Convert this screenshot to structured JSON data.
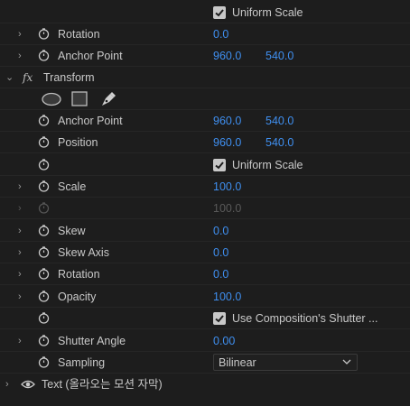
{
  "rows": {
    "uniform_scale_top": "Uniform Scale",
    "rotation_top": {
      "label": "Rotation",
      "value": "0.0"
    },
    "anchor_point_top": {
      "label": "Anchor Point",
      "x": "960.0",
      "y": "540.0"
    },
    "transform": {
      "fx": "fx",
      "label": "Transform"
    },
    "anchor_point": {
      "label": "Anchor Point",
      "x": "960.0",
      "y": "540.0"
    },
    "position": {
      "label": "Position",
      "x": "960.0",
      "y": "540.0"
    },
    "uniform_scale": "Uniform Scale",
    "scale": {
      "label": "Scale",
      "value": "100.0"
    },
    "scale_width": {
      "value": "100.0"
    },
    "skew": {
      "label": "Skew",
      "value": "0.0"
    },
    "skew_axis": {
      "label": "Skew Axis",
      "value": "0.0"
    },
    "rotation": {
      "label": "Rotation",
      "value": "0.0"
    },
    "opacity": {
      "label": "Opacity",
      "value": "100.0"
    },
    "use_comp_shutter": "Use Composition's Shutter ...",
    "shutter_angle": {
      "label": "Shutter Angle",
      "value": "0.00"
    },
    "sampling": {
      "label": "Sampling",
      "value": "Bilinear"
    },
    "text_layer": "Text (올라오는 모션 자막)"
  },
  "icons": {
    "mask_tools": [
      "ellipse-mask-icon",
      "rectangle-mask-icon",
      "pen-mask-icon"
    ]
  },
  "colors": {
    "value_blue": "#3f8ff0",
    "background": "#1d1d1d"
  }
}
